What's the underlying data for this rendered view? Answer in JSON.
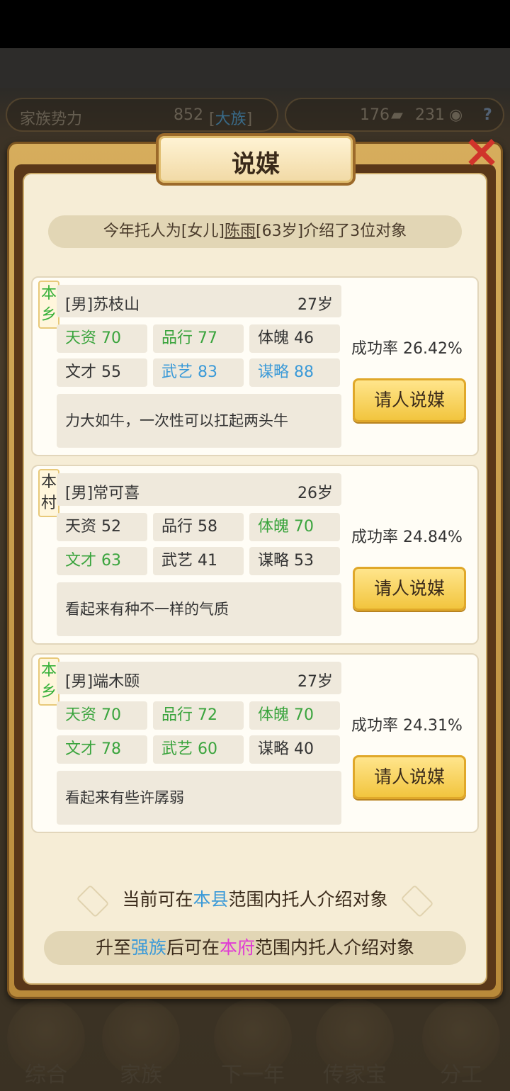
{
  "top_bar": {
    "clan_power_label": "家族势力",
    "clan_power_value": "852",
    "clan_rank": "大族",
    "books_value": "176",
    "coins_value": "231",
    "help": "?"
  },
  "dialog": {
    "title": "说媒",
    "close_icon": "×",
    "summary": {
      "prefix": "今年托人为[女儿]",
      "person": "陈雨",
      "suffix": "[63岁]介绍了3位对象"
    },
    "candidates": [
      {
        "tag": "本乡",
        "name": "[男]苏枝山",
        "age": "27岁",
        "stats": [
          "天资 70",
          "品行 77",
          "体魄 46",
          "文才 55",
          "武艺 83",
          "谋略 88"
        ],
        "desc": "力大如牛，一次性可以扛起两头牛",
        "rate": "成功率 26.42%",
        "button": "请人说媒"
      },
      {
        "tag": "本村",
        "name": "[男]常可喜",
        "age": "26岁",
        "stats": [
          "天资 52",
          "品行 58",
          "体魄 70",
          "文才 63",
          "武艺 41",
          "谋略 53"
        ],
        "desc": "看起来有种不一样的气质",
        "rate": "成功率 24.84%",
        "button": "请人说媒"
      },
      {
        "tag": "本乡",
        "name": "[男]端木颐",
        "age": "27岁",
        "stats": [
          "天资 70",
          "品行 72",
          "体魄 70",
          "文才 78",
          "武艺 60",
          "谋略 40"
        ],
        "desc": "看起来有些许孱弱",
        "rate": "成功率 24.31%",
        "button": "请人说媒"
      }
    ],
    "footer1": {
      "a": "当前可在",
      "b": "本县",
      "c": "范围内托人介绍对象"
    },
    "footer2": {
      "a": "升至",
      "b": "强族",
      "c": "后可在",
      "d": "本府",
      "e": "范围内托人介绍对象"
    }
  },
  "nav": [
    "综合",
    "家族",
    "下一年",
    "传家宝",
    "分工"
  ],
  "colors": {
    "green": "#3aa43d",
    "blue": "#3b9ad8",
    "pink": "#e03bd4",
    "gold": "#f2c53e"
  }
}
